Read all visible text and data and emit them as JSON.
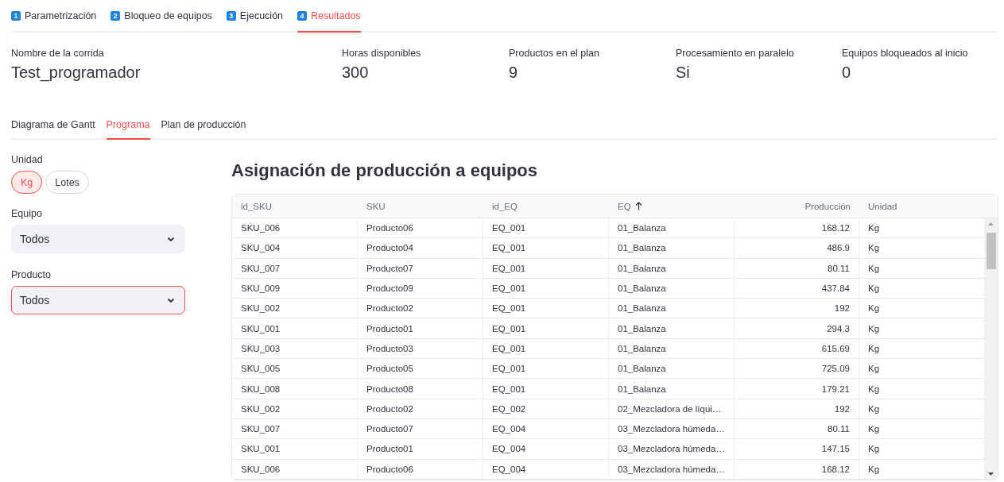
{
  "steps": [
    {
      "number": "1",
      "label": "Parametrización",
      "selected": false
    },
    {
      "number": "2",
      "label": "Bloqueo de equipos",
      "selected": false
    },
    {
      "number": "3",
      "label": "Ejecución",
      "selected": false
    },
    {
      "number": "4",
      "label": "Resultados",
      "selected": true
    }
  ],
  "metrics": [
    {
      "label": "Nombre de la corrida",
      "value": "Test_programador"
    },
    {
      "label": "Horas disponibles",
      "value": "300"
    },
    {
      "label": "Productos en el plan",
      "value": "9"
    },
    {
      "label": "Procesamiento en paralelo",
      "value": "Si"
    },
    {
      "label": "Equipos bloqueados al inicio",
      "value": "0"
    }
  ],
  "tabs": [
    {
      "label": "Diagrama de Gantt",
      "selected": false
    },
    {
      "label": "Programa",
      "selected": true
    },
    {
      "label": "Plan de producción",
      "selected": false
    }
  ],
  "sidebar": {
    "unit": {
      "label": "Unidad",
      "options": [
        {
          "label": "Kg",
          "selected": true
        },
        {
          "label": "Lotes",
          "selected": false
        }
      ]
    },
    "filters": [
      {
        "label": "Equipo",
        "value": "Todos",
        "focused": false
      },
      {
        "label": "Producto",
        "value": "Todos",
        "focused": true
      }
    ]
  },
  "table": {
    "title": "Asignación de producción a equipos",
    "columns": [
      {
        "label": "id_SKU",
        "numeric": false,
        "sorted_ascending": false
      },
      {
        "label": "SKU",
        "numeric": false,
        "sorted_ascending": false
      },
      {
        "label": "id_EQ",
        "numeric": false,
        "sorted_ascending": false
      },
      {
        "label": "EQ",
        "numeric": false,
        "sorted_ascending": true
      },
      {
        "label": "Producción",
        "numeric": true,
        "sorted_ascending": false
      },
      {
        "label": "Unidad",
        "numeric": false,
        "sorted_ascending": false
      }
    ],
    "rows": [
      [
        "SKU_006",
        "Producto06",
        "EQ_001",
        "01_Balanza",
        "168.12",
        "Kg"
      ],
      [
        "SKU_004",
        "Producto04",
        "EQ_001",
        "01_Balanza",
        "486.9",
        "Kg"
      ],
      [
        "SKU_007",
        "Producto07",
        "EQ_001",
        "01_Balanza",
        "80.11",
        "Kg"
      ],
      [
        "SKU_009",
        "Producto09",
        "EQ_001",
        "01_Balanza",
        "437.84",
        "Kg"
      ],
      [
        "SKU_002",
        "Producto02",
        "EQ_001",
        "01_Balanza",
        "192",
        "Kg"
      ],
      [
        "SKU_001",
        "Producto01",
        "EQ_001",
        "01_Balanza",
        "294.3",
        "Kg"
      ],
      [
        "SKU_003",
        "Producto03",
        "EQ_001",
        "01_Balanza",
        "615.69",
        "Kg"
      ],
      [
        "SKU_005",
        "Producto05",
        "EQ_001",
        "01_Balanza",
        "725.09",
        "Kg"
      ],
      [
        "SKU_008",
        "Producto08",
        "EQ_001",
        "01_Balanza",
        "179.21",
        "Kg"
      ],
      [
        "SKU_002",
        "Producto02",
        "EQ_002",
        "02_Mezcladora de líqui…",
        "192",
        "Kg"
      ],
      [
        "SKU_007",
        "Producto07",
        "EQ_004",
        "03_Mezcladora húmeda…",
        "80.11",
        "Kg"
      ],
      [
        "SKU_001",
        "Producto01",
        "EQ_004",
        "03_Mezcladora húmeda…",
        "147.15",
        "Kg"
      ],
      [
        "SKU_006",
        "Producto06",
        "EQ_004",
        "03_Mezcladora húmeda…",
        "168.12",
        "Kg"
      ]
    ]
  }
}
